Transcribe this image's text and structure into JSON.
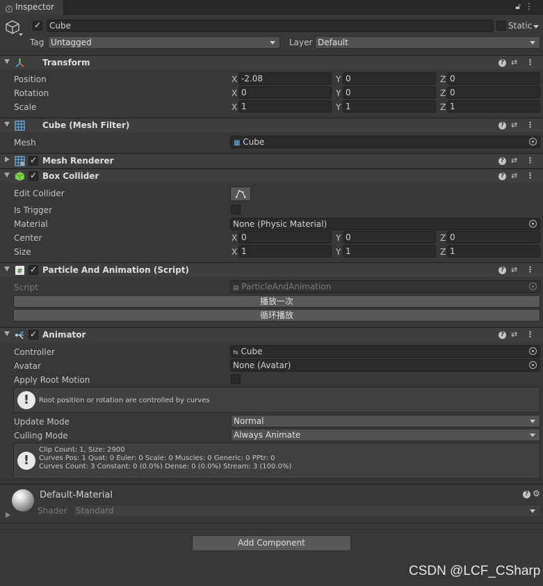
{
  "tab": {
    "title": "Inspector"
  },
  "gameobject": {
    "name": "Cube",
    "static_label": "Static",
    "tag_label": "Tag",
    "tag_value": "Untagged",
    "layer_label": "Layer",
    "layer_value": "Default"
  },
  "transform": {
    "title": "Transform",
    "rows": [
      {
        "label": "Position",
        "x": "-2.08",
        "y": "0",
        "z": "0"
      },
      {
        "label": "Rotation",
        "x": "0",
        "y": "0",
        "z": "0"
      },
      {
        "label": "Scale",
        "x": "1",
        "y": "1",
        "z": "1"
      }
    ]
  },
  "axis": {
    "x": "X",
    "y": "Y",
    "z": "Z"
  },
  "mesh_filter": {
    "title": "Cube (Mesh Filter)",
    "mesh_label": "Mesh",
    "mesh_value": "Cube"
  },
  "mesh_renderer": {
    "title": "Mesh Renderer"
  },
  "box_collider": {
    "title": "Box Collider",
    "edit_label": "Edit Collider",
    "trigger_label": "Is Trigger",
    "material_label": "Material",
    "material_value": "None (Physic Material)",
    "center_label": "Center",
    "center": {
      "x": "0",
      "y": "0",
      "z": "0"
    },
    "size_label": "Size",
    "size": {
      "x": "1",
      "y": "1",
      "z": "1"
    }
  },
  "script_comp": {
    "title": "Particle And Animation (Script)",
    "script_label": "Script",
    "script_value": "ParticleAndAnimation",
    "button1": "播放一次",
    "button2": "循环播放"
  },
  "animator": {
    "title": "Animator",
    "controller_label": "Controller",
    "controller_value": "Cube",
    "avatar_label": "Avatar",
    "avatar_value": "None (Avatar)",
    "root_motion_label": "Apply Root Motion",
    "root_motion_note": "Root position or rotation are controlled by curves",
    "update_label": "Update Mode",
    "update_value": "Normal",
    "culling_label": "Culling Mode",
    "culling_value": "Always Animate",
    "info_line1": "Clip Count: 1, Size: 2900",
    "info_line2": "Curves Pos: 1 Quat: 0 Euler: 0 Scale: 0 Muscles: 0 Generic: 0 PPtr: 0",
    "info_line3": "Curves Count: 3 Constant: 0 (0.0%) Dense: 0 (0.0%) Stream: 3 (100.0%)"
  },
  "material": {
    "name": "Default-Material",
    "shader_label": "Shader",
    "shader_value": "Standard"
  },
  "add_component": "Add Component",
  "watermark": "CSDN @LCF_CSharp"
}
